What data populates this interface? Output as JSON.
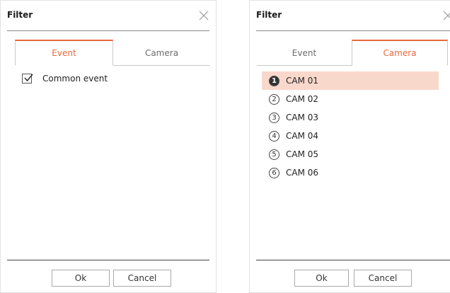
{
  "left_dialog": {
    "title": "Filter",
    "tabs": [
      {
        "label": "Event",
        "active": true
      },
      {
        "label": "Camera",
        "active": false
      }
    ],
    "checkbox": {
      "label": "Common event",
      "checked": true
    },
    "ok_label": "Ok",
    "cancel_label": "Cancel"
  },
  "right_dialog": {
    "title": "Filter",
    "tabs": [
      {
        "label": "Event",
        "active": false
      },
      {
        "label": "Camera",
        "active": true
      }
    ],
    "cameras": [
      {
        "num": "1",
        "label": "CAM 01",
        "selected": true
      },
      {
        "num": "2",
        "label": "CAM 02",
        "selected": false
      },
      {
        "num": "3",
        "label": "CAM 03",
        "selected": false
      },
      {
        "num": "4",
        "label": "CAM 04",
        "selected": false
      },
      {
        "num": "5",
        "label": "CAM 05",
        "selected": false
      },
      {
        "num": "6",
        "label": "CAM 06",
        "selected": false
      }
    ],
    "ok_label": "Ok",
    "cancel_label": "Cancel"
  },
  "colors": {
    "accent": "#e8693c",
    "selected_row": "#f9d8cc"
  },
  "icons": {
    "close": "close-icon",
    "check": "checkmark-icon"
  }
}
